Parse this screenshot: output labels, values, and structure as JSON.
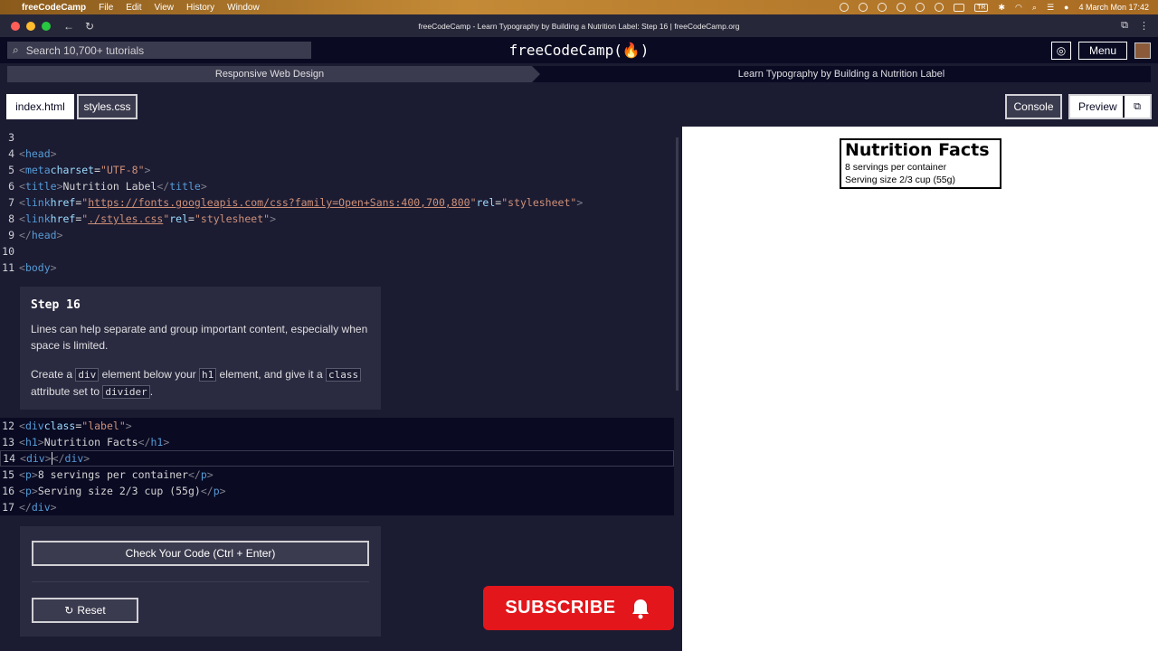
{
  "mac_menubar": {
    "app_name": "freeCodeCamp",
    "menus": [
      "File",
      "Edit",
      "View",
      "History",
      "Window"
    ],
    "input_source": "TR",
    "datetime": "4 March Mon  17:42"
  },
  "browser": {
    "window_title": "freeCodeCamp - Learn Typography by Building a Nutrition Label: Step 16 | freeCodeCamp.org"
  },
  "nav": {
    "search_placeholder": "Search 10,700+ tutorials",
    "logo": "freeCodeCamp(🔥)",
    "menu_label": "Menu"
  },
  "breadcrumb": {
    "section": "Responsive Web Design",
    "project": "Learn Typography by Building a Nutrition Label"
  },
  "tabs": {
    "index": "index.html",
    "styles": "styles.css",
    "console": "Console",
    "preview": "Preview"
  },
  "step": {
    "title": "Step 16",
    "para1": "Lines can help separate and group important content, especially when space is limited.",
    "para2_a": "Create a ",
    "para2_code1": "div",
    "para2_b": " element below your ",
    "para2_code2": "h1",
    "para2_c": " element, and give it a ",
    "para2_code3": "class",
    "para2_d": " attribute set to ",
    "para2_code4": "divider",
    "para2_e": "."
  },
  "code_lines": [
    {
      "n": "3",
      "text": ""
    },
    {
      "n": "4",
      "text": "<head>"
    },
    {
      "n": "5",
      "text": "  <meta charset=\"UTF-8\">"
    },
    {
      "n": "6",
      "text": "  <title>Nutrition Label</title>"
    },
    {
      "n": "7",
      "text": "  <link href=\"https://fonts.googleapis.com/css?family=Open+Sans:400,700,800\" rel=\"stylesheet\">"
    },
    {
      "n": "8",
      "text": "  <link href=\"./styles.css\" rel=\"stylesheet\">"
    },
    {
      "n": "9",
      "text": "</head>"
    },
    {
      "n": "10",
      "text": ""
    },
    {
      "n": "11",
      "text": "<body>"
    },
    {
      "n": "12",
      "text": "  <div class=\"label\">"
    },
    {
      "n": "13",
      "text": "    <h1>Nutrition Facts</h1>"
    },
    {
      "n": "14",
      "text": "    <div></div>"
    },
    {
      "n": "15",
      "text": "    <p>8 servings per container</p>"
    },
    {
      "n": "16",
      "text": "    <p>Serving size 2/3 cup (55g)</p>"
    },
    {
      "n": "17",
      "text": "  </div>"
    }
  ],
  "buttons": {
    "check": "Check Your Code (Ctrl + Enter)",
    "reset": "Reset"
  },
  "overlay": {
    "subscribe": "SUBSCRIBE"
  },
  "preview_label": {
    "title": "Nutrition Facts",
    "servings": "8 servings per container",
    "serving_size": "Serving size 2/3 cup (55g)"
  }
}
